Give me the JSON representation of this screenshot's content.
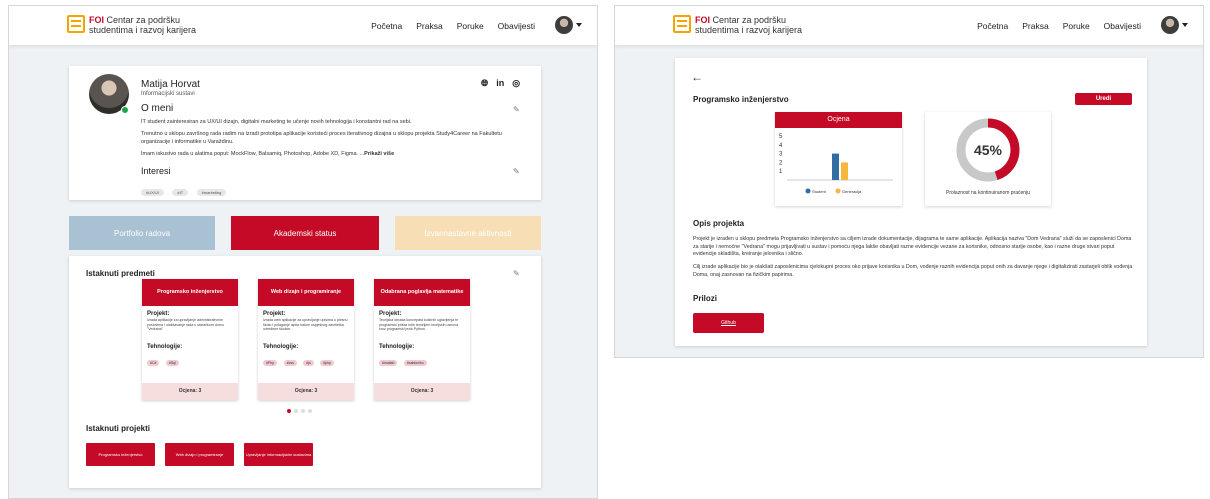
{
  "left": {
    "nav": {
      "brand": "FOI",
      "logo_line1": "Centar za podršku",
      "logo_line2": "studentima i razvoj karijera",
      "items": [
        "Početna",
        "Praksa",
        "Poruke",
        "Obavijesti"
      ]
    },
    "profile": {
      "name": "Matija Horvat",
      "program": "Informacijski sustavi",
      "about_title": "O meni",
      "about_p1": "IT student zainteresiran za UX/UI dizajn, digitalni marketing te učenje novih tehnologija i konstantni rad na sebi.",
      "about_p2": "Trenutno u sklopu završnog rada radim na izradi prototipa aplikacije koristeći proces iterativnog dizajna u sklopu projekta Study4Career na Fakultetu organizacije i informatike u Varaždinu.",
      "about_p3": "Imam iskustvo rada u alatima poput: MockFlow, Balsamiq, Photoshop, Adobe XD, Figma. ...",
      "show_more": "Prikaži više",
      "interests_title": "Interesi",
      "interests": [
        "#UX/UI",
        "#IT",
        "#marketing"
      ]
    },
    "tabs": [
      "Portfolio radova",
      "Akademski status",
      "Izvannastavne aktivnosti"
    ],
    "featured_subjects_title": "Istaknuti predmeti",
    "subjects": [
      {
        "title": "Programsko inženjerstvo",
        "project_label": "Projekt:",
        "project_text": "Izrada aplikacije za upravljanje administrativnim poslovima i olakšavanje rada u staračkom domu \"Vedrana\"",
        "tech_label": "Tehnologije:",
        "tech": [
          "#C#",
          "#Sql"
        ],
        "grade": "Ocjena: 3"
      },
      {
        "title": "Web dizajn i programiranje",
        "project_label": "Projekt:",
        "project_text": "Izrada web aplikacije za upravljanje upisima u plesnu školu i polaganje ispita nakon uspješnog završetka određene školice.",
        "tech_label": "Tehnologije:",
        "tech": [
          "#Php",
          "#css",
          "#js",
          "#php"
        ],
        "grade": "Ocjena: 3"
      },
      {
        "title": "Odabrana poglavlja matematike",
        "project_label": "Projekt:",
        "project_text": "Teorijska obrada koncepata kutičnih uglavljenja te programski prikaz istih temeljem teorijskih osnova kroz programski jezik Python.",
        "tech_label": "Tehnologije:",
        "tech": [
          "#matlab",
          "#sabloniko"
        ],
        "grade": "Ocjena: 3"
      }
    ],
    "featured_projects_title": "Istaknuti projekti",
    "projects": [
      "Programsko inženjerstvo",
      "Web dizajn i programiranje",
      "Upravljanje informacijskim sustavima"
    ]
  },
  "right": {
    "nav": {
      "brand": "FOI",
      "logo_line1": "Centar za podršku",
      "logo_line2": "studentima i razvoj karijera",
      "items": [
        "Početna",
        "Praksa",
        "Poruke",
        "Obavijesti"
      ]
    },
    "back": "←",
    "title": "Programsko inženjerstvo",
    "edit": "Uredi",
    "chart_title": "Ocjena",
    "gauge_caption": "Prolaznost na kontinuiranom praćenju",
    "desc_title": "Opis projekta",
    "desc_p1": "Projekt je izrađen u sklopu predmeta Programsko inženjerstvo sa ciljem izrade dokumentacije, dijagrama te same aplikacije. Aplikacija naziva \"Dom Vedrana\" služi da se zaposlenici Doma za starije i nemoćne \"Vedrana\" mogu prijavljivati u sustav i pomoću njega lakše obavljati razne evidencije vezane za korisnike, odnosno starije osobe, kao i razne druge stvari poput evidencije skladišta, kreiranje jelovnika i slično.",
    "desc_p2": "Cilj izrade aplikacije bio je olakšati zaposlenicima cjelokupni proces oko prijave korisnika u Dom, vođenje raznih evidencija poput onih za davanje njege i digitalizirati zastarjeli oblik vođenja Doma, onaj zasnovan na fizičkim papirima.",
    "attachments_title": "Prilozi",
    "attachment_button": "Github"
  },
  "chart_data": [
    {
      "type": "bar",
      "title": "Ocjena",
      "categories": [
        "Ocjena"
      ],
      "series": [
        {
          "name": "Student",
          "values": [
            3
          ],
          "color": "#2f6da3"
        },
        {
          "name": "Generacija",
          "values": [
            2
          ],
          "color": "#f5b83d"
        }
      ],
      "ylim": [
        0,
        5
      ],
      "yticks": [
        1,
        2,
        3,
        4,
        5
      ],
      "legend": "bottom"
    },
    {
      "type": "pie",
      "title": "Prolaznost na kontinuiranom praćenju",
      "values": [
        45,
        55
      ],
      "label": "45%",
      "colors": [
        "#c40a26",
        "#c8c8c8"
      ]
    }
  ],
  "colors": {
    "brand_red": "#c40a26",
    "tab_blue": "#a8c1d3",
    "tab_orange": "#f8deb4",
    "logo_orange": "#f2a400"
  }
}
